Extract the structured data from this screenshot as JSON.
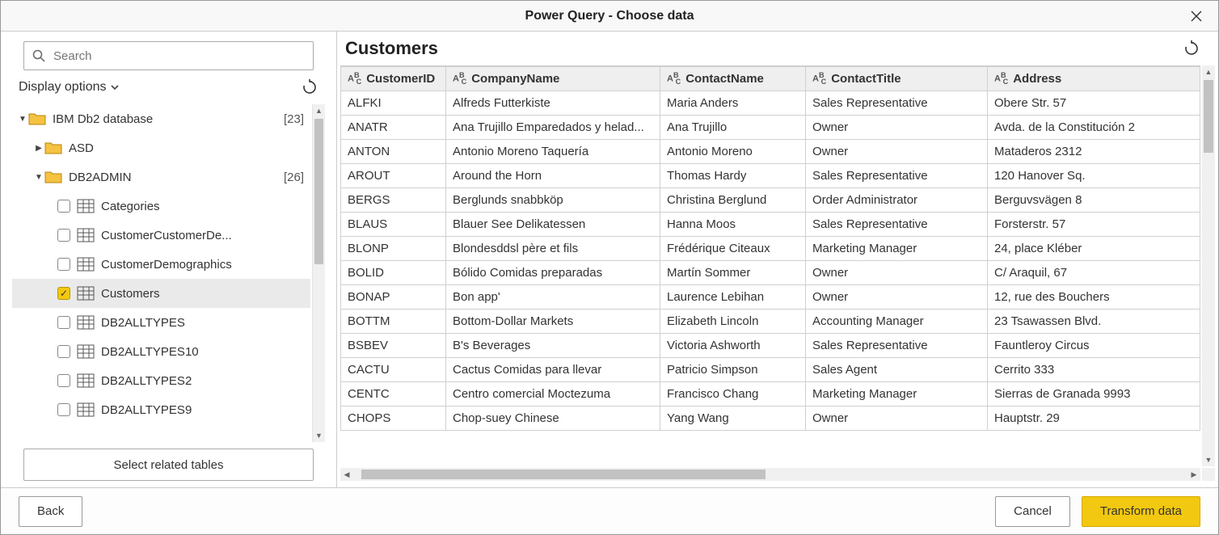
{
  "window": {
    "title": "Power Query - Choose data"
  },
  "left": {
    "search_placeholder": "Search",
    "display_options_label": "Display options",
    "select_related_label": "Select related tables",
    "tree": {
      "root": {
        "label": "IBM Db2 database",
        "count": "[23]"
      },
      "child1": {
        "label": "ASD"
      },
      "child2": {
        "label": "DB2ADMIN",
        "count": "[26]"
      },
      "tables": [
        {
          "label": "Categories",
          "checked": false
        },
        {
          "label": "CustomerCustomerDe...",
          "checked": false
        },
        {
          "label": "CustomerDemographics",
          "checked": false
        },
        {
          "label": "Customers",
          "checked": true
        },
        {
          "label": "DB2ALLTYPES",
          "checked": false
        },
        {
          "label": "DB2ALLTYPES10",
          "checked": false
        },
        {
          "label": "DB2ALLTYPES2",
          "checked": false
        },
        {
          "label": "DB2ALLTYPES9",
          "checked": false
        }
      ]
    }
  },
  "right": {
    "heading": "Customers",
    "columns": [
      "CustomerID",
      "CompanyName",
      "ContactName",
      "ContactTitle",
      "Address"
    ],
    "rows": [
      [
        "ALFKI",
        "Alfreds Futterkiste",
        "Maria Anders",
        "Sales Representative",
        "Obere Str. 57"
      ],
      [
        "ANATR",
        "Ana Trujillo Emparedados y helad...",
        "Ana Trujillo",
        "Owner",
        "Avda. de la Constitución 2"
      ],
      [
        "ANTON",
        "Antonio Moreno Taquería",
        "Antonio Moreno",
        "Owner",
        "Mataderos 2312"
      ],
      [
        "AROUT",
        "Around the Horn",
        "Thomas Hardy",
        "Sales Representative",
        "120 Hanover Sq."
      ],
      [
        "BERGS",
        "Berglunds snabbköp",
        "Christina Berglund",
        "Order Administrator",
        "Berguvsvägen 8"
      ],
      [
        "BLAUS",
        "Blauer See Delikatessen",
        "Hanna Moos",
        "Sales Representative",
        "Forsterstr. 57"
      ],
      [
        "BLONP",
        "Blondesddsl père et fils",
        "Frédérique Citeaux",
        "Marketing Manager",
        "24, place Kléber"
      ],
      [
        "BOLID",
        "Bólido Comidas preparadas",
        "Martín Sommer",
        "Owner",
        "C/ Araquil, 67"
      ],
      [
        "BONAP",
        "Bon app'",
        "Laurence Lebihan",
        "Owner",
        "12, rue des Bouchers"
      ],
      [
        "BOTTM",
        "Bottom-Dollar Markets",
        "Elizabeth Lincoln",
        "Accounting Manager",
        "23 Tsawassen Blvd."
      ],
      [
        "BSBEV",
        "B's Beverages",
        "Victoria Ashworth",
        "Sales Representative",
        "Fauntleroy Circus"
      ],
      [
        "CACTU",
        "Cactus Comidas para llevar",
        "Patricio Simpson",
        "Sales Agent",
        "Cerrito 333"
      ],
      [
        "CENTC",
        "Centro comercial Moctezuma",
        "Francisco Chang",
        "Marketing Manager",
        "Sierras de Granada 9993"
      ],
      [
        "CHOPS",
        "Chop-suey Chinese",
        "Yang Wang",
        "Owner",
        "Hauptstr. 29"
      ]
    ]
  },
  "footer": {
    "back": "Back",
    "cancel": "Cancel",
    "transform": "Transform data"
  }
}
